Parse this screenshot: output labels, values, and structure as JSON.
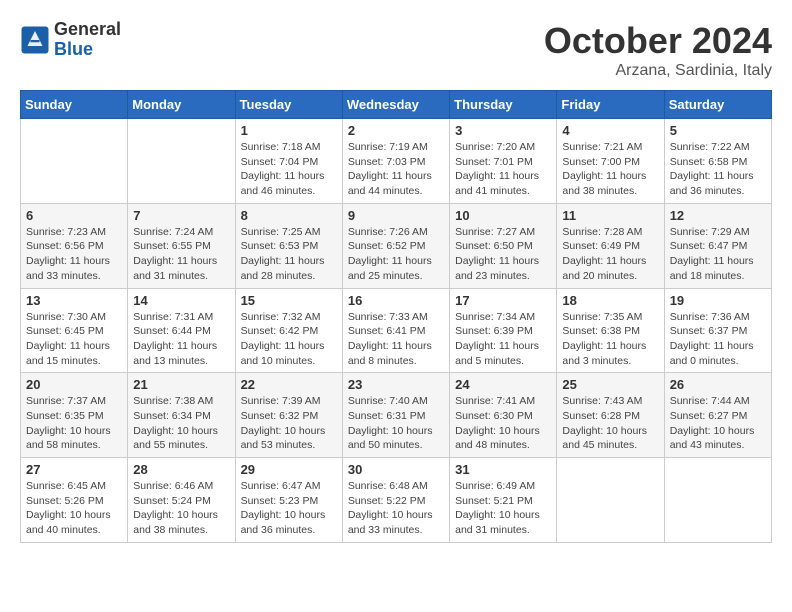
{
  "header": {
    "logo_line1": "General",
    "logo_line2": "Blue",
    "title": "October 2024",
    "subtitle": "Arzana, Sardinia, Italy"
  },
  "days_of_week": [
    "Sunday",
    "Monday",
    "Tuesday",
    "Wednesday",
    "Thursday",
    "Friday",
    "Saturday"
  ],
  "weeks": [
    [
      {
        "day": "",
        "info": ""
      },
      {
        "day": "",
        "info": ""
      },
      {
        "day": "1",
        "info": "Sunrise: 7:18 AM\nSunset: 7:04 PM\nDaylight: 11 hours and 46 minutes."
      },
      {
        "day": "2",
        "info": "Sunrise: 7:19 AM\nSunset: 7:03 PM\nDaylight: 11 hours and 44 minutes."
      },
      {
        "day": "3",
        "info": "Sunrise: 7:20 AM\nSunset: 7:01 PM\nDaylight: 11 hours and 41 minutes."
      },
      {
        "day": "4",
        "info": "Sunrise: 7:21 AM\nSunset: 7:00 PM\nDaylight: 11 hours and 38 minutes."
      },
      {
        "day": "5",
        "info": "Sunrise: 7:22 AM\nSunset: 6:58 PM\nDaylight: 11 hours and 36 minutes."
      }
    ],
    [
      {
        "day": "6",
        "info": "Sunrise: 7:23 AM\nSunset: 6:56 PM\nDaylight: 11 hours and 33 minutes."
      },
      {
        "day": "7",
        "info": "Sunrise: 7:24 AM\nSunset: 6:55 PM\nDaylight: 11 hours and 31 minutes."
      },
      {
        "day": "8",
        "info": "Sunrise: 7:25 AM\nSunset: 6:53 PM\nDaylight: 11 hours and 28 minutes."
      },
      {
        "day": "9",
        "info": "Sunrise: 7:26 AM\nSunset: 6:52 PM\nDaylight: 11 hours and 25 minutes."
      },
      {
        "day": "10",
        "info": "Sunrise: 7:27 AM\nSunset: 6:50 PM\nDaylight: 11 hours and 23 minutes."
      },
      {
        "day": "11",
        "info": "Sunrise: 7:28 AM\nSunset: 6:49 PM\nDaylight: 11 hours and 20 minutes."
      },
      {
        "day": "12",
        "info": "Sunrise: 7:29 AM\nSunset: 6:47 PM\nDaylight: 11 hours and 18 minutes."
      }
    ],
    [
      {
        "day": "13",
        "info": "Sunrise: 7:30 AM\nSunset: 6:45 PM\nDaylight: 11 hours and 15 minutes."
      },
      {
        "day": "14",
        "info": "Sunrise: 7:31 AM\nSunset: 6:44 PM\nDaylight: 11 hours and 13 minutes."
      },
      {
        "day": "15",
        "info": "Sunrise: 7:32 AM\nSunset: 6:42 PM\nDaylight: 11 hours and 10 minutes."
      },
      {
        "day": "16",
        "info": "Sunrise: 7:33 AM\nSunset: 6:41 PM\nDaylight: 11 hours and 8 minutes."
      },
      {
        "day": "17",
        "info": "Sunrise: 7:34 AM\nSunset: 6:39 PM\nDaylight: 11 hours and 5 minutes."
      },
      {
        "day": "18",
        "info": "Sunrise: 7:35 AM\nSunset: 6:38 PM\nDaylight: 11 hours and 3 minutes."
      },
      {
        "day": "19",
        "info": "Sunrise: 7:36 AM\nSunset: 6:37 PM\nDaylight: 11 hours and 0 minutes."
      }
    ],
    [
      {
        "day": "20",
        "info": "Sunrise: 7:37 AM\nSunset: 6:35 PM\nDaylight: 10 hours and 58 minutes."
      },
      {
        "day": "21",
        "info": "Sunrise: 7:38 AM\nSunset: 6:34 PM\nDaylight: 10 hours and 55 minutes."
      },
      {
        "day": "22",
        "info": "Sunrise: 7:39 AM\nSunset: 6:32 PM\nDaylight: 10 hours and 53 minutes."
      },
      {
        "day": "23",
        "info": "Sunrise: 7:40 AM\nSunset: 6:31 PM\nDaylight: 10 hours and 50 minutes."
      },
      {
        "day": "24",
        "info": "Sunrise: 7:41 AM\nSunset: 6:30 PM\nDaylight: 10 hours and 48 minutes."
      },
      {
        "day": "25",
        "info": "Sunrise: 7:43 AM\nSunset: 6:28 PM\nDaylight: 10 hours and 45 minutes."
      },
      {
        "day": "26",
        "info": "Sunrise: 7:44 AM\nSunset: 6:27 PM\nDaylight: 10 hours and 43 minutes."
      }
    ],
    [
      {
        "day": "27",
        "info": "Sunrise: 6:45 AM\nSunset: 5:26 PM\nDaylight: 10 hours and 40 minutes."
      },
      {
        "day": "28",
        "info": "Sunrise: 6:46 AM\nSunset: 5:24 PM\nDaylight: 10 hours and 38 minutes."
      },
      {
        "day": "29",
        "info": "Sunrise: 6:47 AM\nSunset: 5:23 PM\nDaylight: 10 hours and 36 minutes."
      },
      {
        "day": "30",
        "info": "Sunrise: 6:48 AM\nSunset: 5:22 PM\nDaylight: 10 hours and 33 minutes."
      },
      {
        "day": "31",
        "info": "Sunrise: 6:49 AM\nSunset: 5:21 PM\nDaylight: 10 hours and 31 minutes."
      },
      {
        "day": "",
        "info": ""
      },
      {
        "day": "",
        "info": ""
      }
    ]
  ]
}
